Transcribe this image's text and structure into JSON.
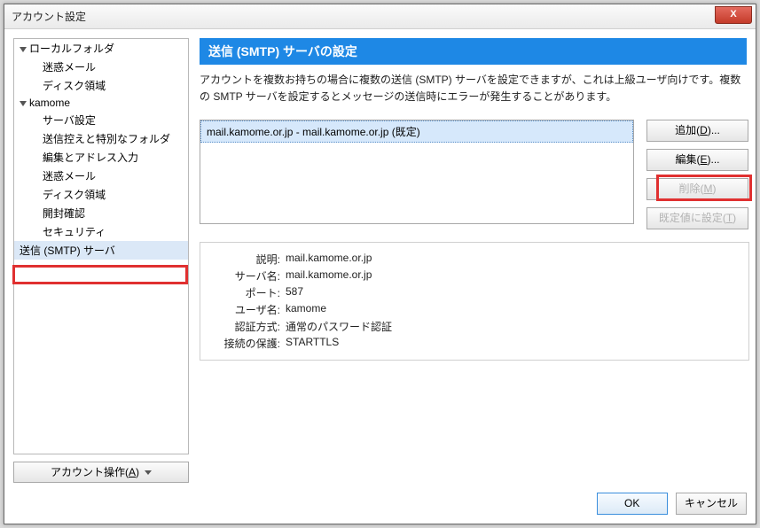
{
  "window": {
    "title": "アカウント設定"
  },
  "tree": {
    "local_folder": "ローカルフォルダ",
    "local_children": [
      "迷惑メール",
      "ディスク領域"
    ],
    "account": "kamome",
    "account_children": [
      "サーバ設定",
      "送信控えと特別なフォルダ",
      "編集とアドレス入力",
      "迷惑メール",
      "ディスク領域",
      "開封確認",
      "セキュリティ"
    ],
    "smtp": "送信 (SMTP) サーバ"
  },
  "account_ops": {
    "label": "アカウント操作(",
    "access": "A",
    "suffix": ")"
  },
  "banner": "送信 (SMTP) サーバの設定",
  "description": "アカウントを複数お持ちの場合に複数の送信 (SMTP) サーバを設定できますが、これは上級ユーザ向けです。複数の SMTP サーバを設定するとメッセージの送信時にエラーが発生することがあります。",
  "server_list": {
    "items": [
      "mail.kamome.or.jp - mail.kamome.or.jp (既定)"
    ]
  },
  "buttons": {
    "add": {
      "label": "追加(",
      "access": "D",
      "suffix": ")...",
      "enabled": true
    },
    "edit": {
      "label": "編集(",
      "access": "E",
      "suffix": ")...",
      "enabled": true
    },
    "remove": {
      "label": "削除(",
      "access": "M",
      "suffix": ")",
      "enabled": false
    },
    "default": {
      "label": "既定値に設定(",
      "access": "T",
      "suffix": ")",
      "enabled": false
    }
  },
  "details": {
    "labels": {
      "desc": "説明:",
      "server": "サーバ名:",
      "port": "ポート:",
      "user": "ユーザ名:",
      "auth": "認証方式:",
      "sec": "接続の保護:"
    },
    "values": {
      "desc": "mail.kamome.or.jp",
      "server": "mail.kamome.or.jp",
      "port": "587",
      "user": "kamome",
      "auth": "通常のパスワード認証",
      "sec": "STARTTLS"
    }
  },
  "footer": {
    "ok": "OK",
    "cancel": "キャンセル"
  },
  "close_glyph": "X"
}
